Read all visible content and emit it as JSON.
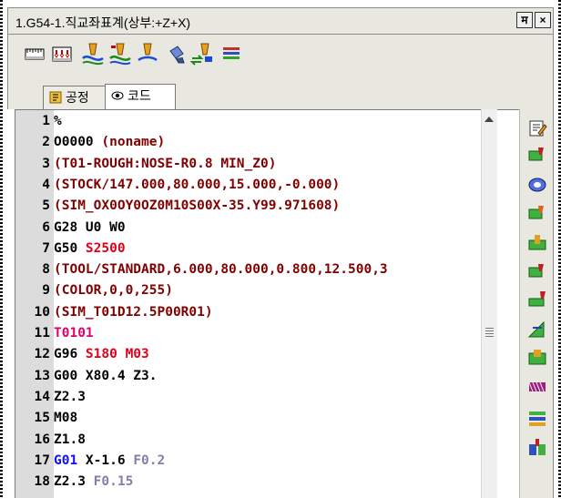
{
  "window": {
    "title": "1.G54-1.직교좌표계(상부:+Z+X)",
    "pin_label": "म",
    "close_label": "×"
  },
  "toolbar": {
    "icons": [
      "ruler-icon",
      "ruler-down-icon",
      "tool-path-icon",
      "tool-path-green-icon",
      "tool-drill-icon",
      "tool-paint-icon",
      "tool-swap-icon",
      "layers-icon"
    ]
  },
  "tabs": [
    {
      "label": "공정",
      "icon": "process-icon",
      "active": false
    },
    {
      "label": "코드",
      "icon": "eye-icon",
      "active": true
    }
  ],
  "code_lines": [
    {
      "n": "1",
      "parts": [
        {
          "t": "%",
          "c": "plain"
        }
      ]
    },
    {
      "n": "2",
      "parts": [
        {
          "t": "O0000 ",
          "c": "plain"
        },
        {
          "t": "(noname)",
          "c": "comment"
        }
      ]
    },
    {
      "n": "3",
      "parts": [
        {
          "t": "(T01-ROUGH:NOSE-R0.8 MIN_Z0)",
          "c": "comment"
        }
      ]
    },
    {
      "n": "4",
      "parts": [
        {
          "t": "(STOCK/147.000,80.000,15.000,-0.000)",
          "c": "comment"
        }
      ]
    },
    {
      "n": "5",
      "parts": [
        {
          "t": "(SIM_OX0OY0OZ0M10S00X-35.Y99.971608)",
          "c": "comment"
        }
      ]
    },
    {
      "n": "6",
      "parts": [
        {
          "t": "G28 U0 W0",
          "c": "plain"
        }
      ]
    },
    {
      "n": "7",
      "parts": [
        {
          "t": "G50 ",
          "c": "plain"
        },
        {
          "t": "S2500",
          "c": "red"
        }
      ]
    },
    {
      "n": "8",
      "parts": [
        {
          "t": "(TOOL/STANDARD,6.000,80.000,0.800,12.500,3",
          "c": "comment"
        }
      ]
    },
    {
      "n": "9",
      "parts": [
        {
          "t": "(COLOR,0,0,255)",
          "c": "comment"
        }
      ]
    },
    {
      "n": "10",
      "parts": [
        {
          "t": "(SIM_T01D12.5P00R01)",
          "c": "comment"
        }
      ]
    },
    {
      "n": "11",
      "parts": [
        {
          "t": "T0101",
          "c": "mag"
        }
      ]
    },
    {
      "n": "12",
      "parts": [
        {
          "t": "G96 ",
          "c": "plain"
        },
        {
          "t": "S180 ",
          "c": "red"
        },
        {
          "t": "M03",
          "c": "red"
        }
      ]
    },
    {
      "n": "13",
      "parts": [
        {
          "t": "G00 X80.4 Z3.",
          "c": "plain"
        }
      ]
    },
    {
      "n": "14",
      "parts": [
        {
          "t": "Z2.3",
          "c": "plain"
        }
      ]
    },
    {
      "n": "15",
      "parts": [
        {
          "t": "M08",
          "c": "plain"
        }
      ]
    },
    {
      "n": "16",
      "parts": [
        {
          "t": "Z1.8",
          "c": "plain"
        }
      ]
    },
    {
      "n": "17",
      "parts": [
        {
          "t": "G01 ",
          "c": "blue"
        },
        {
          "t": "X-1.6 ",
          "c": "plain"
        },
        {
          "t": "F0.2",
          "c": "gray"
        }
      ]
    },
    {
      "n": "18",
      "parts": [
        {
          "t": "Z2.3 ",
          "c": "plain"
        },
        {
          "t": "F0.15",
          "c": "gray"
        }
      ]
    }
  ],
  "sidebar": {
    "icons": [
      "edit-icon",
      "turning-icon",
      "boring-icon",
      "face-icon",
      "groove-icon",
      "profile-icon",
      "thread-icon",
      "edge-icon",
      "pocket-icon",
      "knurl-icon",
      "drill-pattern-icon",
      "mill-icon"
    ]
  }
}
